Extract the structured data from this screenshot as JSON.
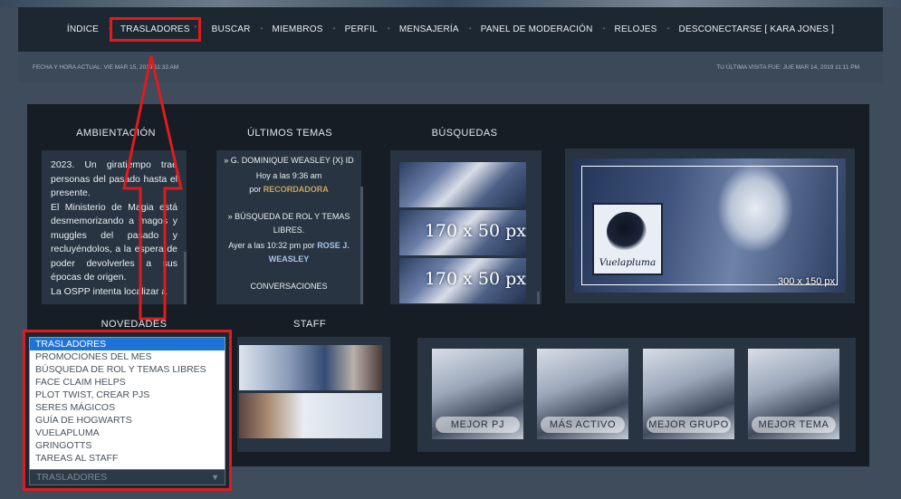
{
  "nav": {
    "items": [
      "ÍNDICE",
      "TRASLADORES",
      "BUSCAR",
      "MIEMBROS",
      "PERFIL",
      "MENSAJERÍA",
      "PANEL DE MODERACIÓN",
      "RELOJES",
      "DESCONECTARSE [ KARA JONES ]"
    ],
    "highlighted_index": 1
  },
  "info": {
    "current_time": "FECHA Y HORA ACTUAL: VIE MAR 15, 2019 11:33 AM",
    "last_visit": "TU ÚLTIMA VISITA FUE: JUE MAR 14, 2019 11:11 PM"
  },
  "sections": {
    "ambient": "AMBIENTACIÓN",
    "topics": "ÚLTIMOS TEMAS",
    "searches": "BÚSQUEDAS",
    "news": "NOVEDADES",
    "staff": "STAFF"
  },
  "ambient_text": [
    "2023. Un giratiempo trae personas del pasado hasta el presente.",
    "El Ministerio de Magia está desmemorizando a magos y muggles del pasado y recluyéndolos, a la espera de poder devolverles a sus épocas de origen.",
    "La OSPP intenta localizar a"
  ],
  "topics": [
    {
      "title": "» G. DOMINIQUE WEASLEY {X} ID",
      "when": "Hoy a las 9:36 am",
      "by": "por",
      "user": "RECORDADORA"
    },
    {
      "title": "» BÚSQUEDA DE ROL Y TEMAS LIBRES.",
      "when": "Ayer a las 10:32 pm por",
      "by": "",
      "user": "ROSE J. WEASLEY"
    },
    {
      "title": "CONVERSACIONES"
    }
  ],
  "search_images": [
    "",
    "170 x 50 px",
    "170 x 50 px"
  ],
  "hero": {
    "logo_text": "Vuelapluma",
    "size_text": "300 x 150 px"
  },
  "dropdown": {
    "options": [
      "TRASLADORES",
      "PROMOCIONES DEL MES",
      "BÚSQUEDA DE ROL Y TEMAS LIBRES",
      "FACE CLAIM HELPS",
      "PLOT TWIST, CREAR PJS",
      "SERES MÁGICOS",
      "GUÍA DE HOGWARTS",
      "VUELAPLUMA",
      "GRINGOTTS",
      "TAREAS AL STAFF"
    ],
    "selected": "TRASLADORES",
    "caret": "▼"
  },
  "awards": [
    "MEJOR PJ",
    "MÁS ACTIVO",
    "MEJOR GRUPO",
    "MEJOR TEMA"
  ],
  "colors": {
    "highlight": "#e11b1b",
    "accent_user": "#c9a35c",
    "select_blue": "#1e73d6"
  }
}
